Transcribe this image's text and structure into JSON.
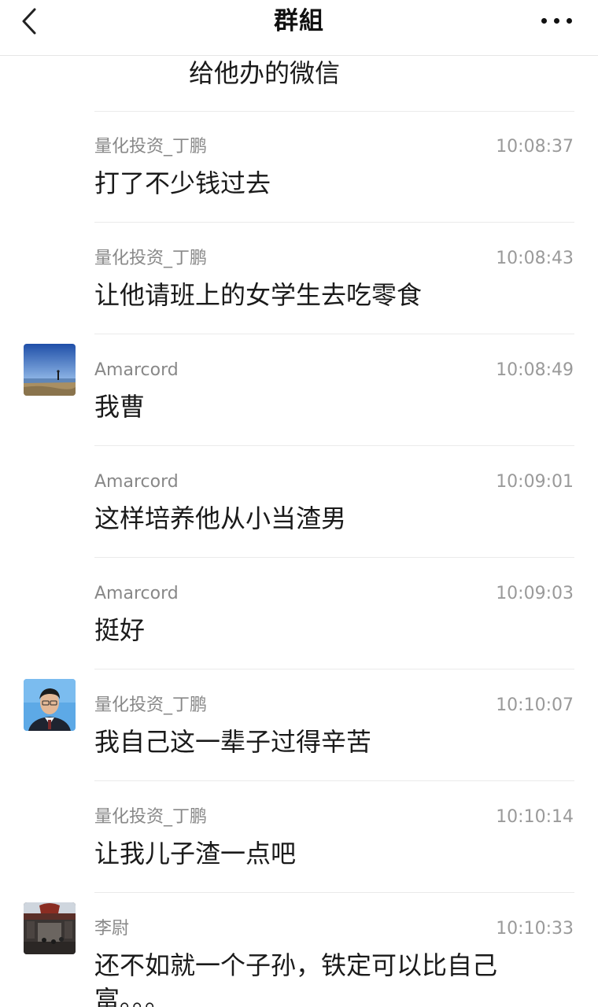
{
  "header": {
    "title": "群組",
    "back_icon": "chevron-left-icon",
    "more_icon": "more-horizontal-icon"
  },
  "partial_message": {
    "text": "给他办的微信"
  },
  "messages": [
    {
      "sender": "量化投资_丁鹏",
      "time": "10:08:37",
      "text": "打了不少钱过去",
      "avatar": false
    },
    {
      "sender": "量化投资_丁鹏",
      "time": "10:08:43",
      "text": "让他请班上的女学生去吃零食",
      "avatar": false
    },
    {
      "sender": "Amarcord",
      "time": "10:08:49",
      "text": "我曹",
      "avatar": true
    },
    {
      "sender": "Amarcord",
      "time": "10:09:01",
      "text": "这样培养他从小当渣男",
      "avatar": false
    },
    {
      "sender": "Amarcord",
      "time": "10:09:03",
      "text": "挺好",
      "avatar": false
    },
    {
      "sender": "量化投资_丁鹏",
      "time": "10:10:07",
      "text": "我自己这一辈子过得辛苦",
      "avatar": true
    },
    {
      "sender": "量化投资_丁鹏",
      "time": "10:10:14",
      "text": "让我儿子渣一点吧",
      "avatar": false
    },
    {
      "sender": "李尉",
      "time": "10:10:33",
      "text": "还不如就一个子孙，铁定可以比自己富。。。",
      "avatar": true
    }
  ]
}
